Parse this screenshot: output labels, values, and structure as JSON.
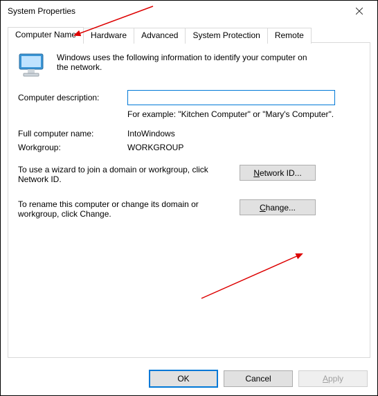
{
  "window": {
    "title": "System Properties"
  },
  "tabs": {
    "computer_name": "Computer Name",
    "hardware": "Hardware",
    "advanced": "Advanced",
    "system_protection": "System Protection",
    "remote": "Remote"
  },
  "panel": {
    "intro": "Windows uses the following information to identify your computer on the network.",
    "description_label": "Computer description:",
    "description_value": "",
    "description_hint": "For example: \"Kitchen Computer\" or \"Mary's Computer\".",
    "fullname_label": "Full computer name:",
    "fullname_value": "IntoWindows",
    "workgroup_label": "Workgroup:",
    "workgroup_value": "WORKGROUP",
    "networkid_text": "To use a wizard to join a domain or workgroup, click Network ID.",
    "networkid_button_pre": "N",
    "networkid_button_post": "etwork ID...",
    "change_text": "To rename this computer or change its domain or workgroup, click Change.",
    "change_button_pre": "C",
    "change_button_post": "hange..."
  },
  "buttons": {
    "ok": "OK",
    "cancel": "Cancel",
    "apply": "Apply"
  }
}
